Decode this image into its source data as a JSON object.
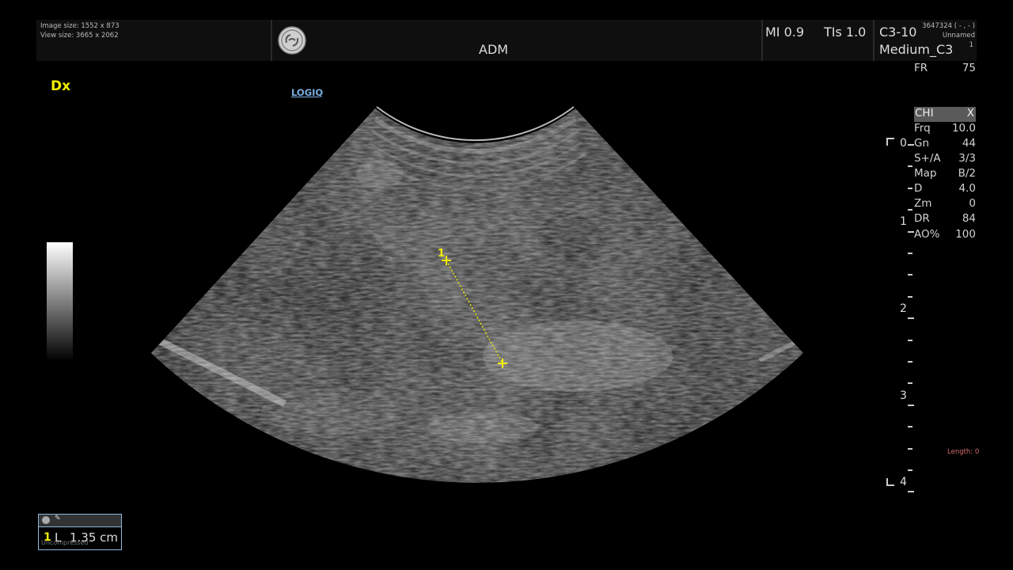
{
  "header": {
    "image_size": "Image size: 1552 x 873",
    "view_size": "View size: 3665 x 2062",
    "mode": "ADM",
    "mi": "MI 0.9",
    "tis": "TIs 1.0",
    "probe": "C3-10",
    "preset": "Medium_C3",
    "patient_id": "3647324 ( - , - )",
    "patient_name": "Unnamed",
    "page": "1"
  },
  "left": {
    "dx_label": "Dx",
    "logiq_link": "LOGIQ"
  },
  "params": {
    "fr_key": "FR",
    "fr_val": "75",
    "head_key": "CHI",
    "head_val": "X",
    "rows": [
      {
        "k": "Frq",
        "v": "10.0"
      },
      {
        "k": "Gn",
        "v": "44"
      },
      {
        "k": "S+/A",
        "v": "3/3"
      },
      {
        "k": "Map",
        "v": "B/2"
      },
      {
        "k": "D",
        "v": "4.0"
      },
      {
        "k": "Zm",
        "v": "0"
      },
      {
        "k": "DR",
        "v": "84"
      },
      {
        "k": "AO%",
        "v": "100"
      }
    ]
  },
  "depth": {
    "labels": [
      "0",
      "1",
      "2",
      "3",
      "4"
    ]
  },
  "length_readout": "Length: 0",
  "measurement": {
    "marker_label": "1",
    "box_index": "1",
    "box_type": "L",
    "box_value": "1.35 cm",
    "compression": "Uncompressed"
  },
  "colors": {
    "caliper": "#f2f000",
    "link": "#7aaee0",
    "length": "#d66a6a"
  }
}
